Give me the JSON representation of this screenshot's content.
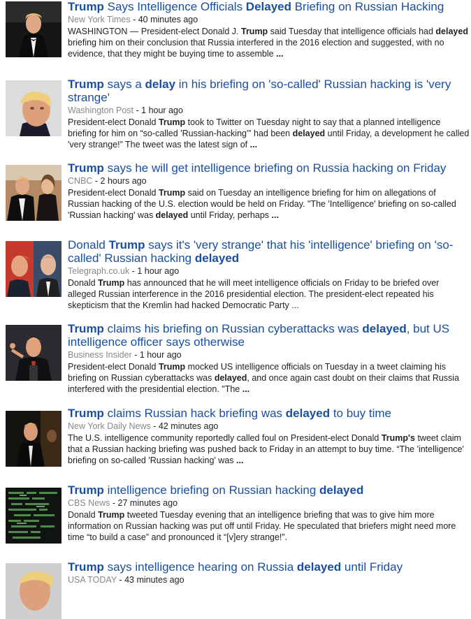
{
  "results": [
    {
      "title": [
        "Trump",
        " Says Intelligence Officials ",
        "Delayed",
        " Briefing on Russian Hacking"
      ],
      "source": "New York Times",
      "time": "40 minutes ago",
      "snippet": [
        "WASHINGTON — President-elect Donald J. ",
        "Trump",
        " said Tuesday that intelligence officials had ",
        "delayed",
        " briefing him on their conclusion that Russia interfered in the 2016 election and suggested, with no evidence, that they might be buying time to assemble ",
        "...",
        ""
      ],
      "thumb": "photo-trump-tuxedo"
    },
    {
      "title": [
        "Trump",
        " says a ",
        "delay",
        " in his briefing on 'so-called' Russian hacking is 'very strange'"
      ],
      "source": "Washington Post",
      "time": "1 hour ago",
      "snippet": [
        "President-elect Donald ",
        "Trump",
        " took to Twitter on Tuesday night to say that a planned intelligence briefing for him on “so-called 'Russian-hacking'” had been ",
        "delayed",
        " until Friday, a development he called 'very strange!” The tweet was the latest sign of ",
        "...",
        ""
      ],
      "thumb": "photo-trump-portrait"
    },
    {
      "title": [
        "Trump",
        " says he will get intelligence briefing on Russia hacking on Friday",
        "",
        ""
      ],
      "source": "CNBC",
      "time": "2 hours ago",
      "snippet": [
        "President-elect Donald ",
        "Trump",
        " said on Tuesday an intelligence briefing for him on allegations of Russian hacking of the U.S. election would be held on Friday. \"The 'Intelligence' briefing on so-called 'Russian hacking' was ",
        "delayed",
        " until Friday, perhaps ",
        "...",
        ""
      ],
      "thumb": "photo-trump-couple"
    },
    {
      "title": [
        "Donald ",
        "Trump",
        " says it's 'very strange' that his 'intelligence' briefing on 'so-called' Russian hacking ",
        "delayed"
      ],
      "source": "Telegraph.co.uk",
      "time": "1 hour ago",
      "snippet": [
        "Donald ",
        "Trump",
        " has announced that he will meet intelligence officials on Friday to be briefed over alleged Russian interference in the 2016 presidential election. The president-elect repeated his skepticism that the Kremlin had hacked Democratic Party ...",
        "",
        "",
        "",
        ""
      ],
      "thumb": "photo-trump-putin"
    },
    {
      "title": [
        "Trump",
        " claims his briefing on Russian cyberattacks was ",
        "delayed",
        ", but US intelligence officer says otherwise"
      ],
      "source": "Business Insider",
      "time": "1 hour ago",
      "snippet": [
        "President-elect Donald ",
        "Trump",
        " mocked US intelligence officials on Tuesday in a tweet claiming his briefing on Russian cyberattacks was ",
        "delayed",
        ", and once again cast doubt on their claims that Russia interfered with the presidential election. \"The ",
        "...",
        ""
      ],
      "thumb": "photo-trump-pointing"
    },
    {
      "title": [
        "Trump",
        " claims Russian hack briefing was ",
        "delayed",
        " to buy time"
      ],
      "source": "New York Daily News",
      "time": "42 minutes ago",
      "snippet": [
        "The U.S. intelligence community reportedly called foul on President-elect Donald ",
        "Trump's",
        " tweet claim that a Russian hacking briefing was pushed back to Friday in an attempt to buy time. “The 'intelligence' briefing on so-called 'Russian hacking' was ",
        "...",
        "",
        "",
        ""
      ],
      "thumb": "photo-trump-stage"
    },
    {
      "title": [
        "Trump",
        " intelligence briefing on Russian hacking ",
        "delayed",
        ""
      ],
      "source": "CBS News",
      "time": "27 minutes ago",
      "snippet": [
        "Donald ",
        "Trump",
        " tweeted Tuesday evening that an intelligence briefing that was to give him more information on Russian hacking was put off until Friday. He speculated that briefers might need more time “to build a case” and pronounced it “[v]ery strange!”.",
        "",
        "",
        "",
        ""
      ],
      "thumb": "photo-code-screen"
    },
    {
      "title": [
        "Trump",
        " says intelligence hearing on Russia ",
        "delayed",
        " until Friday"
      ],
      "source": "USA TODAY",
      "time": "43 minutes ago",
      "snippet": [
        "",
        "",
        "",
        "",
        "",
        "",
        ""
      ],
      "thumb": "photo-trump-partial"
    }
  ],
  "colors": {
    "link": "#1a4fa0",
    "source": "#888888",
    "text": "#222222"
  }
}
